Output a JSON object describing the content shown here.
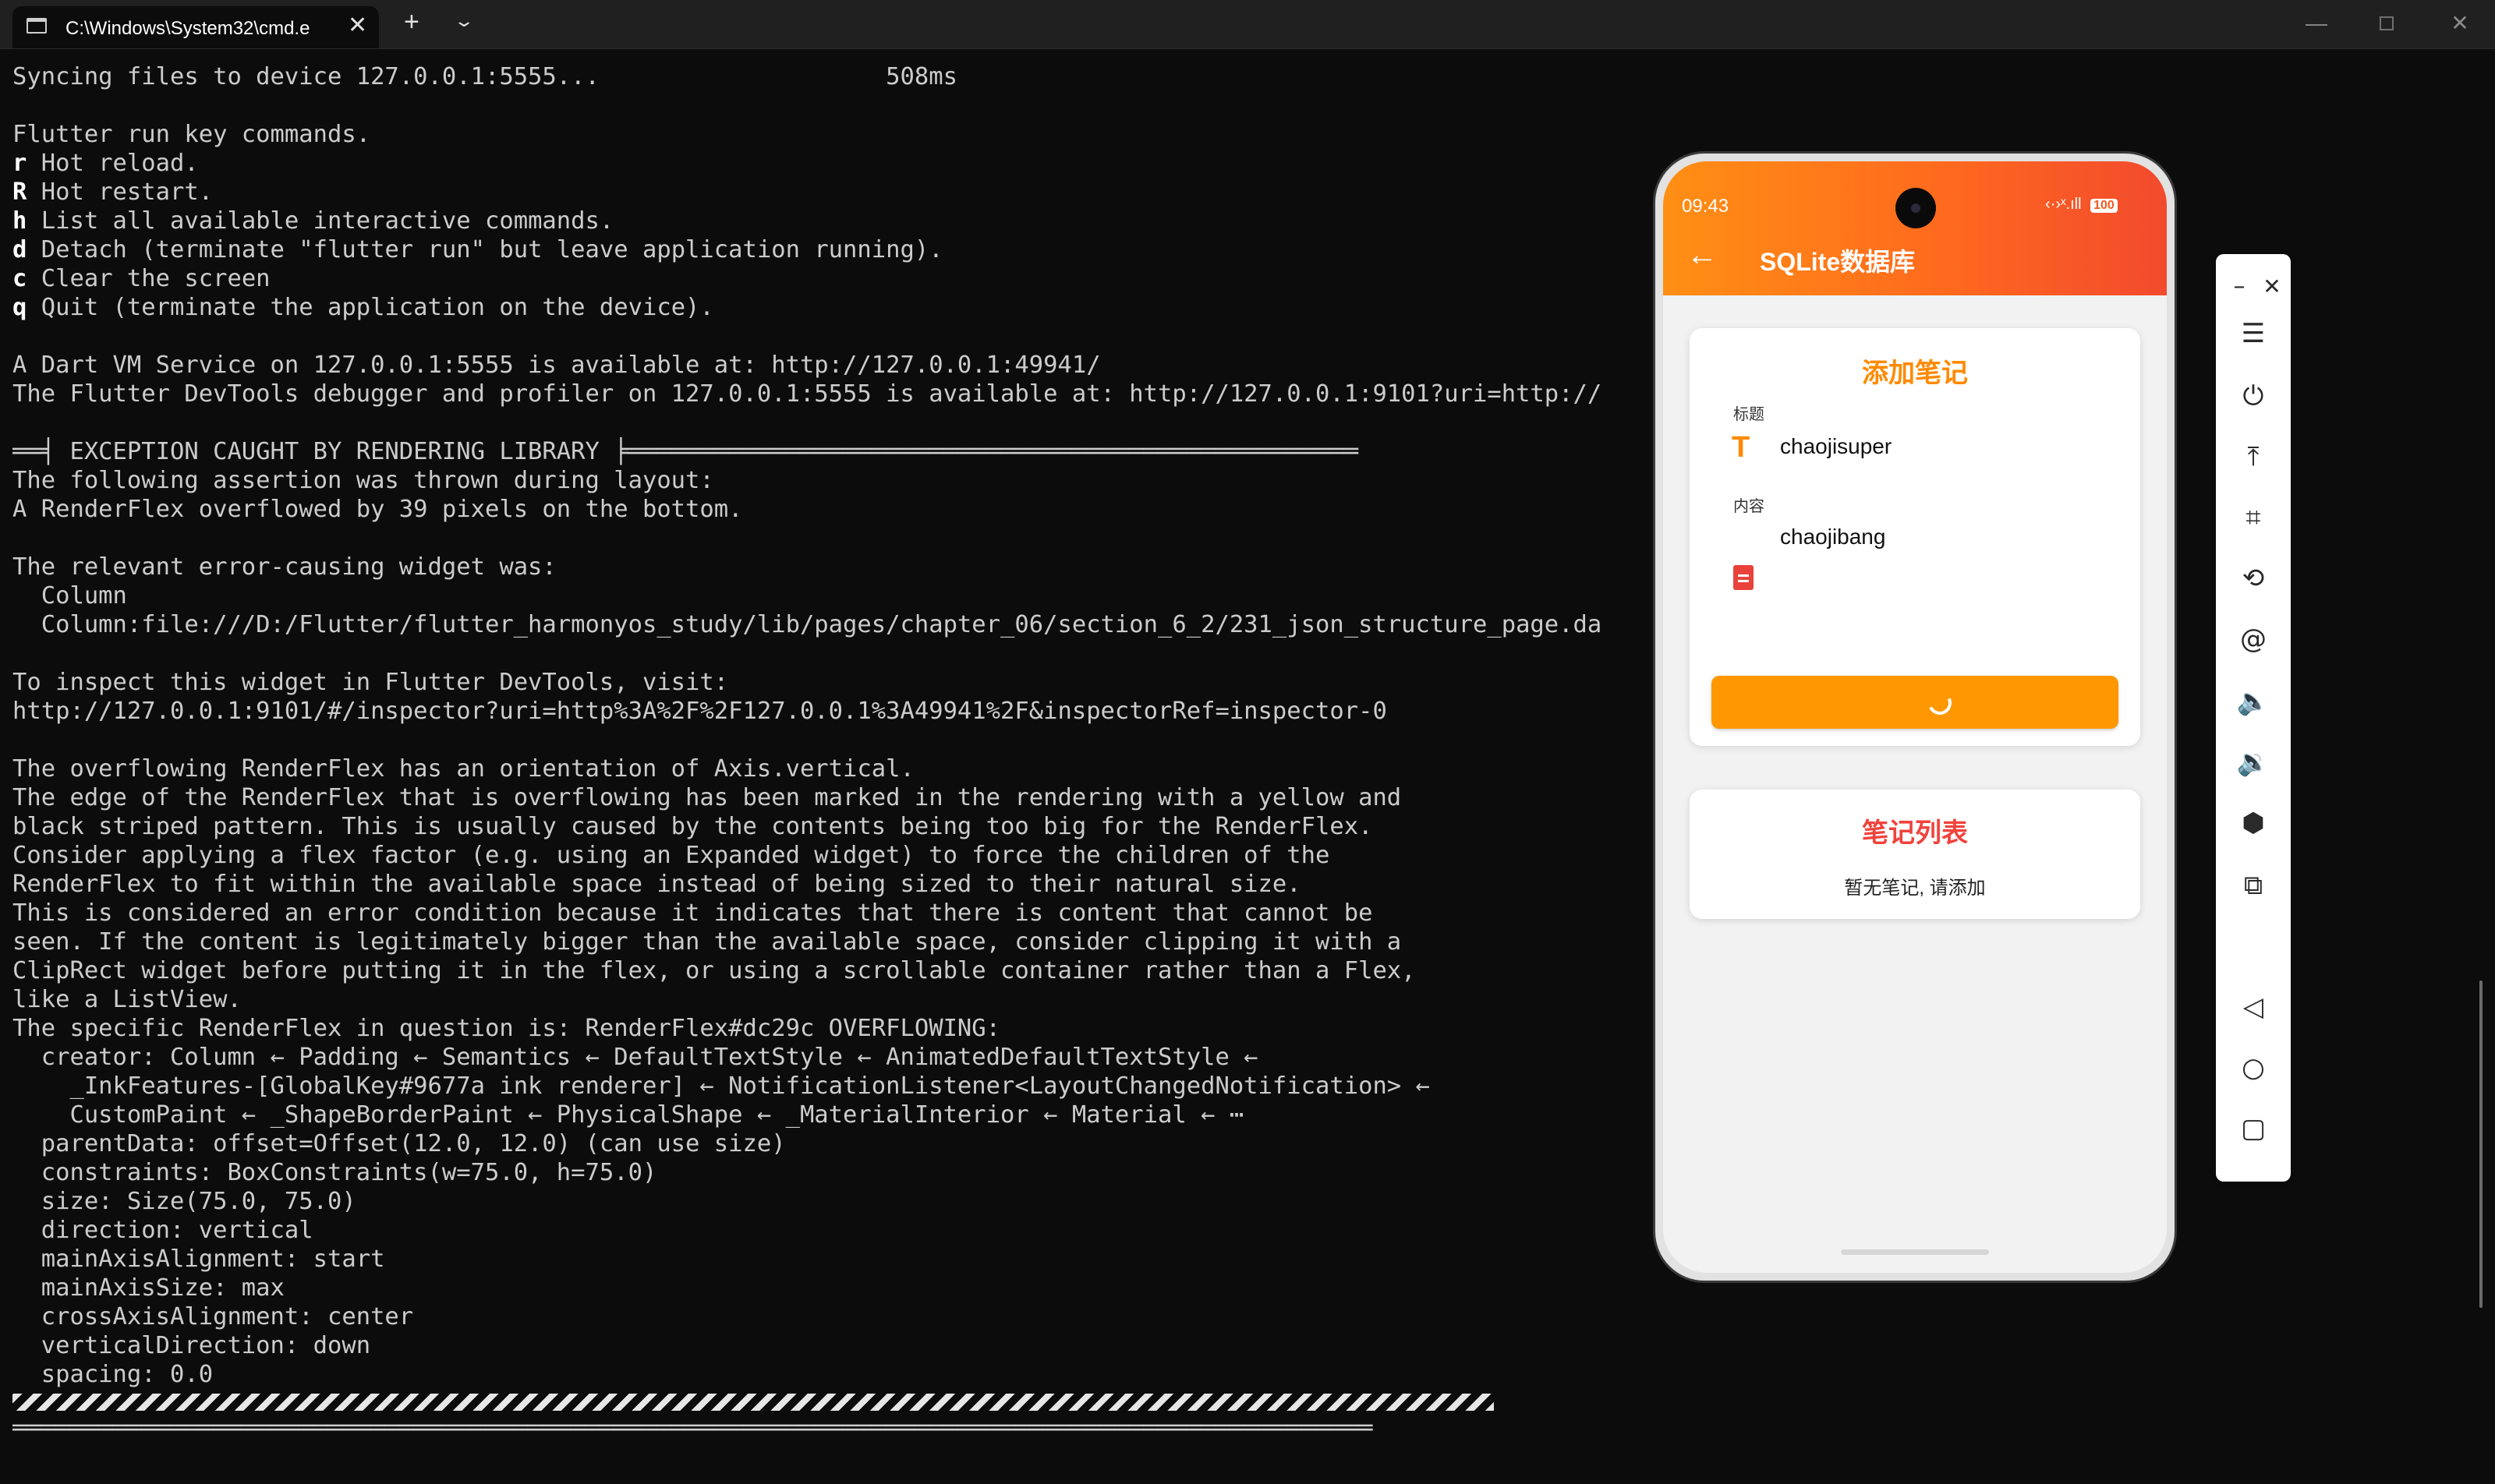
{
  "window": {
    "tab_title": "C:\\Windows\\System32\\cmd.e",
    "tab_close": "✕",
    "new_tab": "+",
    "tab_dropdown": "⌄",
    "minimize": "—",
    "close": "✕"
  },
  "terminal": {
    "lines": [
      {
        "k": "",
        "t": "Syncing files to device 127.0.0.1:5555...                    508ms"
      },
      {
        "k": "",
        "t": ""
      },
      {
        "k": "",
        "t": "Flutter run key commands."
      },
      {
        "k": "r",
        "t": " Hot reload."
      },
      {
        "k": "R",
        "t": " Hot restart."
      },
      {
        "k": "h",
        "t": " List all available interactive commands."
      },
      {
        "k": "d",
        "t": " Detach (terminate \"flutter run\" but leave application running)."
      },
      {
        "k": "c",
        "t": " Clear the screen"
      },
      {
        "k": "q",
        "t": " Quit (terminate the application on the device)."
      },
      {
        "k": "",
        "t": ""
      },
      {
        "k": "",
        "t": "A Dart VM Service on 127.0.0.1:5555 is available at: http://127.0.0.1:49941/"
      },
      {
        "k": "",
        "t": "The Flutter DevTools debugger and profiler on 127.0.0.1:5555 is available at: http://127.0.0.1:9101?uri=http://"
      },
      {
        "k": "",
        "t": ""
      },
      {
        "k": "",
        "t": "══╡ EXCEPTION CAUGHT BY RENDERING LIBRARY ╞═══════════════════════════════════════════════════"
      },
      {
        "k": "",
        "t": "The following assertion was thrown during layout:"
      },
      {
        "k": "",
        "t": "A RenderFlex overflowed by 39 pixels on the bottom."
      },
      {
        "k": "",
        "t": ""
      },
      {
        "k": "",
        "t": "The relevant error-causing widget was:"
      },
      {
        "k": "",
        "t": "  Column"
      },
      {
        "k": "",
        "t": "  Column:file:///D:/Flutter/flutter_harmonyos_study/lib/pages/chapter_06/section_6_2/231_json_structure_page.da"
      },
      {
        "k": "",
        "t": ""
      },
      {
        "k": "",
        "t": "To inspect this widget in Flutter DevTools, visit:"
      },
      {
        "k": "",
        "t": "http://127.0.0.1:9101/#/inspector?uri=http%3A%2F%2F127.0.0.1%3A49941%2F&inspectorRef=inspector-0"
      },
      {
        "k": "",
        "t": ""
      },
      {
        "k": "",
        "t": "The overflowing RenderFlex has an orientation of Axis.vertical."
      },
      {
        "k": "",
        "t": "The edge of the RenderFlex that is overflowing has been marked in the rendering with a yellow and"
      },
      {
        "k": "",
        "t": "black striped pattern. This is usually caused by the contents being too big for the RenderFlex."
      },
      {
        "k": "",
        "t": "Consider applying a flex factor (e.g. using an Expanded widget) to force the children of the"
      },
      {
        "k": "",
        "t": "RenderFlex to fit within the available space instead of being sized to their natural size."
      },
      {
        "k": "",
        "t": "This is considered an error condition because it indicates that there is content that cannot be"
      },
      {
        "k": "",
        "t": "seen. If the content is legitimately bigger than the available space, consider clipping it with a"
      },
      {
        "k": "",
        "t": "ClipRect widget before putting it in the flex, or using a scrollable container rather than a Flex,"
      },
      {
        "k": "",
        "t": "like a ListView."
      },
      {
        "k": "",
        "t": "The specific RenderFlex in question is: RenderFlex#dc29c OVERFLOWING:"
      },
      {
        "k": "",
        "t": "  creator: Column ← Padding ← Semantics ← DefaultTextStyle ← AnimatedDefaultTextStyle ←"
      },
      {
        "k": "",
        "t": "    _InkFeatures-[GlobalKey#9677a ink renderer] ← NotificationListener<LayoutChangedNotification> ←"
      },
      {
        "k": "",
        "t": "    CustomPaint ← _ShapeBorderPaint ← PhysicalShape ← _MaterialInterior ← Material ← ⋯"
      },
      {
        "k": "",
        "t": "  parentData: offset=Offset(12.0, 12.0) (can use size)"
      },
      {
        "k": "",
        "t": "  constraints: BoxConstraints(w=75.0, h=75.0)"
      },
      {
        "k": "",
        "t": "  size: Size(75.0, 75.0)"
      },
      {
        "k": "",
        "t": "  direction: vertical"
      },
      {
        "k": "",
        "t": "  mainAxisAlignment: start"
      },
      {
        "k": "",
        "t": "  mainAxisSize: max"
      },
      {
        "k": "",
        "t": "  crossAxisAlignment: center"
      },
      {
        "k": "",
        "t": "  verticalDirection: down"
      },
      {
        "k": "",
        "t": "  spacing: 0.0"
      }
    ],
    "footer_rule": "═══════════════════════════════════════════════════════════════════════════════════════════════"
  },
  "phone": {
    "status_time": "09:43",
    "status_icons": "‹·›ˣ.ıll",
    "battery": "100",
    "back_icon": "←",
    "app_title": "SQLite数据库",
    "add_card": {
      "title": "添加笔记",
      "title_label": "标题",
      "title_icon": "T",
      "title_value": "chaojisuper",
      "content_label": "内容",
      "content_value": "chaojibang"
    },
    "list_card": {
      "title": "笔记列表",
      "empty_text": "暂无笔记, 请添加"
    }
  },
  "emulator_toolbar": {
    "minimize": "–",
    "close": "✕",
    "buttons": [
      {
        "name": "menu-icon",
        "glyph": "☰"
      },
      {
        "name": "power-icon",
        "glyph": "⏻"
      },
      {
        "name": "upload-icon",
        "glyph": "⤒"
      },
      {
        "name": "crop-screenshot-icon",
        "glyph": "⌗"
      },
      {
        "name": "rotate-icon",
        "glyph": "⟲"
      },
      {
        "name": "at-sign-icon",
        "glyph": "@"
      },
      {
        "name": "volume-up-icon",
        "glyph": "🔈"
      },
      {
        "name": "volume-down-icon",
        "glyph": "🔉"
      },
      {
        "name": "shake-icon",
        "glyph": "⬢"
      },
      {
        "name": "multi-device-icon",
        "glyph": "⧉"
      },
      {
        "name": "back-nav-icon",
        "glyph": "◁"
      },
      {
        "name": "home-nav-icon",
        "glyph": "○"
      },
      {
        "name": "recents-nav-icon",
        "glyph": "▢"
      }
    ]
  }
}
